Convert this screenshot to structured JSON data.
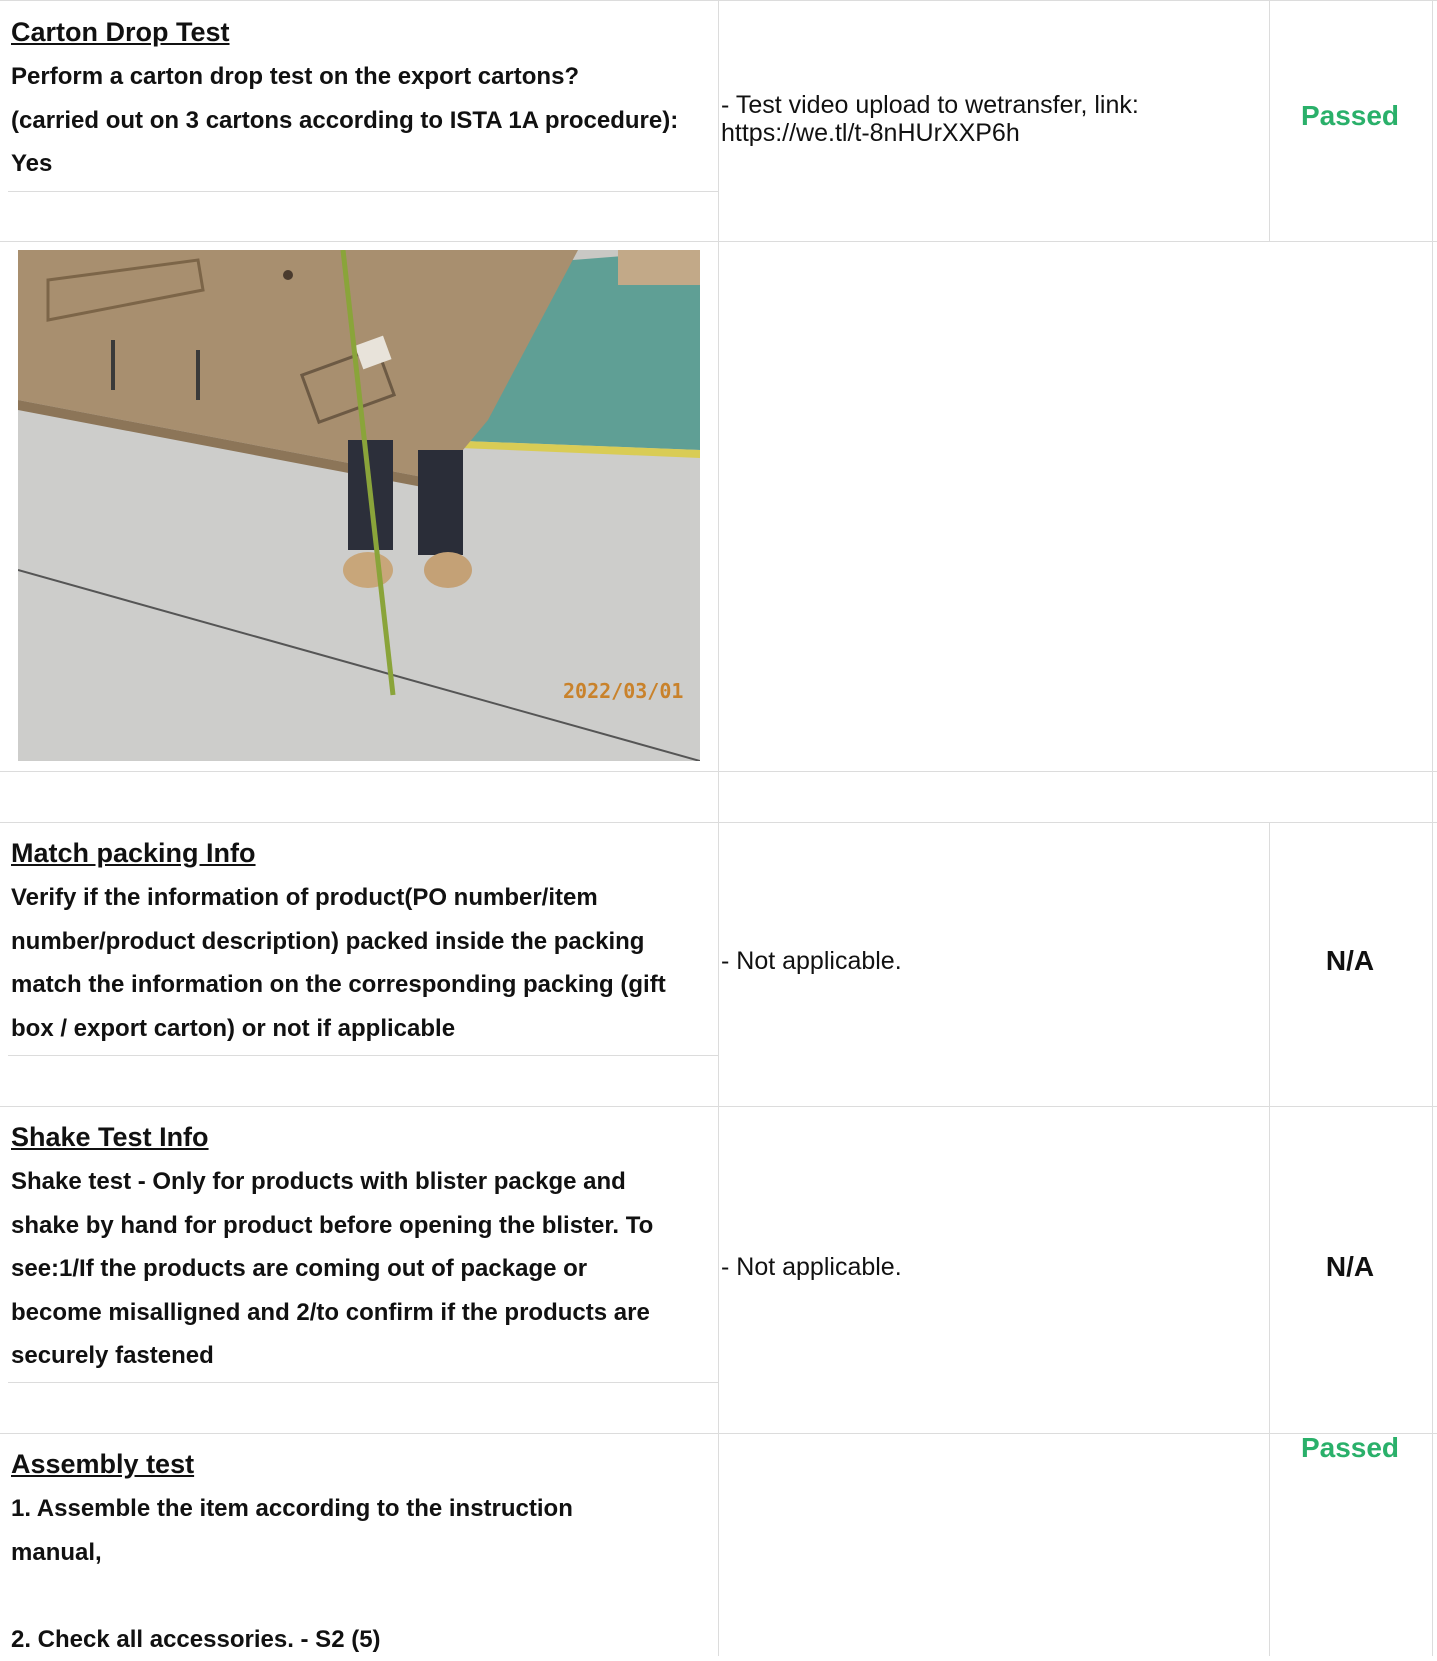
{
  "sections": [
    {
      "title": "Carton Drop Test",
      "description_lines": [
        "Perform a carton drop test on the export cartons?",
        "(carried out on 3 cartons according to ISTA 1A procedure):",
        "Yes"
      ],
      "finding_lines": [
        "- Test video upload to wetransfer, link:",
        "https://we.tl/t-8nHUrXXP6h"
      ],
      "result": "Passed"
    },
    {
      "title": "Match packing Info",
      "description_lines": [
        "Verify if the information of product(PO number/item",
        "number/product description) packed inside the packing",
        "match the information on the corresponding packing (gift",
        "box / export carton) or not if applicable"
      ],
      "finding_lines": [
        "- Not applicable."
      ],
      "result": "N/A"
    },
    {
      "title": "Shake Test Info",
      "description_lines": [
        "Shake test - Only for products with blister packge and",
        "shake by hand for product before opening the blister. To",
        "see:1/If the products are coming out of package or",
        "become misalligned and 2/to confirm if the products are",
        "securely fastened"
      ],
      "finding_lines": [
        "- Not applicable."
      ],
      "result": "N/A"
    },
    {
      "title": "Assembly test",
      "description_lines": [
        "1. Assemble the item according to the instruction",
        "manual,",
        "",
        "2. Check all accessories. - S2 (5)"
      ],
      "finding_lines": [],
      "result": "Passed"
    }
  ],
  "photo": {
    "timestamp": "2022/03/01",
    "subject": "carton-drop-test-photo"
  },
  "colors": {
    "passed": "#2ab06a",
    "border": "#dcdcdc"
  }
}
